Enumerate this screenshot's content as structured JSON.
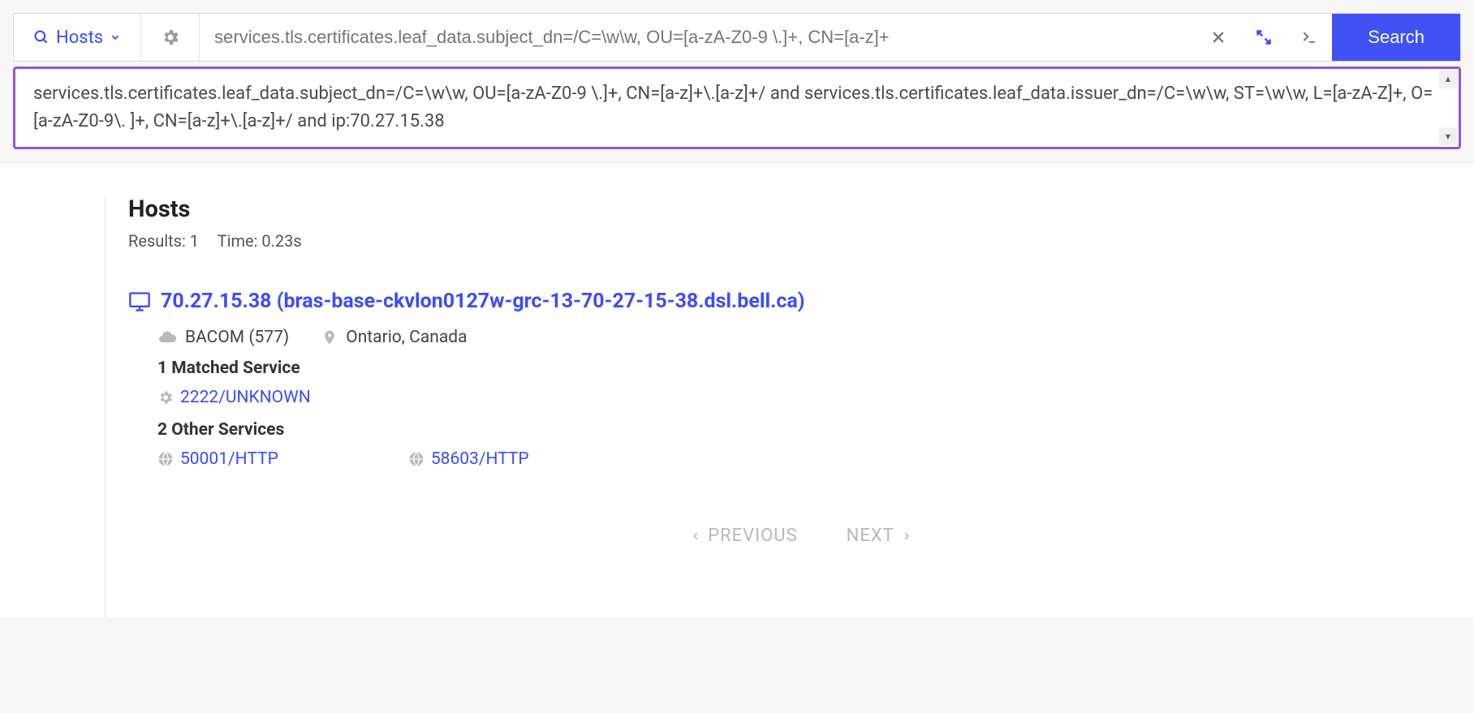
{
  "search": {
    "dropdown_label": "Hosts",
    "placeholder": "services.tls.certificates.leaf_data.subject_dn=/C=\\w\\w, OU=[a-zA-Z0-9 \\.]+, CN=[a-z]+",
    "button_label": "Search",
    "expanded_query": "services.tls.certificates.leaf_data.subject_dn=/C=\\w\\w, OU=[a-zA-Z0-9 \\.]+, CN=[a-z]+\\.[a-z]+/ and services.tls.certificates.leaf_data.issuer_dn=/C=\\w\\w, ST=\\w\\w, L=[a-zA-Z]+, O=[a-zA-Z0-9\\. ]+, CN=[a-z]+\\.[a-z]+/ and ip:70.27.15.38"
  },
  "results": {
    "title": "Hosts",
    "count_label": "Results: 1",
    "time_label": "Time: 0.23s",
    "host": {
      "ip": "70.27.15.38",
      "hostname": "(bras-base-ckvlon0127w-grc-13-70-27-15-38.dsl.bell.ca)",
      "asn": "BACOM (577)",
      "location": "Ontario, Canada",
      "matched_label": "1 Matched Service",
      "matched_service": "2222/UNKNOWN",
      "other_label": "2 Other Services",
      "other_services": [
        "50001/HTTP",
        "58603/HTTP"
      ]
    }
  },
  "pager": {
    "prev": "PREVIOUS",
    "next": "NEXT"
  }
}
